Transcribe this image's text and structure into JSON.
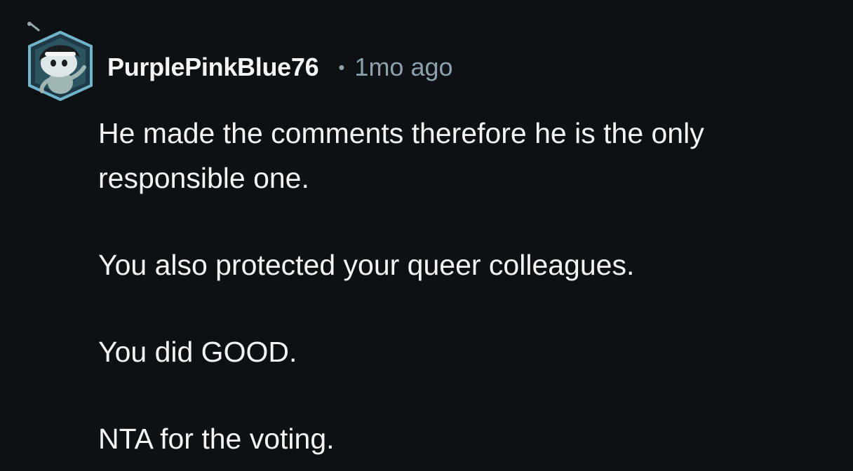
{
  "comment": {
    "author": "PurplePinkBlue76",
    "separator": "•",
    "timestamp": "1mo ago",
    "avatar_icon": "snoo-avatar-icon",
    "paragraphs": [
      "He made the comments therefore he is the only responsible one.",
      "You also protected your queer colleagues.",
      "You did GOOD.",
      "NTA for the voting."
    ]
  },
  "colors": {
    "background": "#0e1113",
    "text": "#f2f4f5",
    "meta": "#8ba2ad",
    "avatar_frame": "#6fb4c9"
  }
}
